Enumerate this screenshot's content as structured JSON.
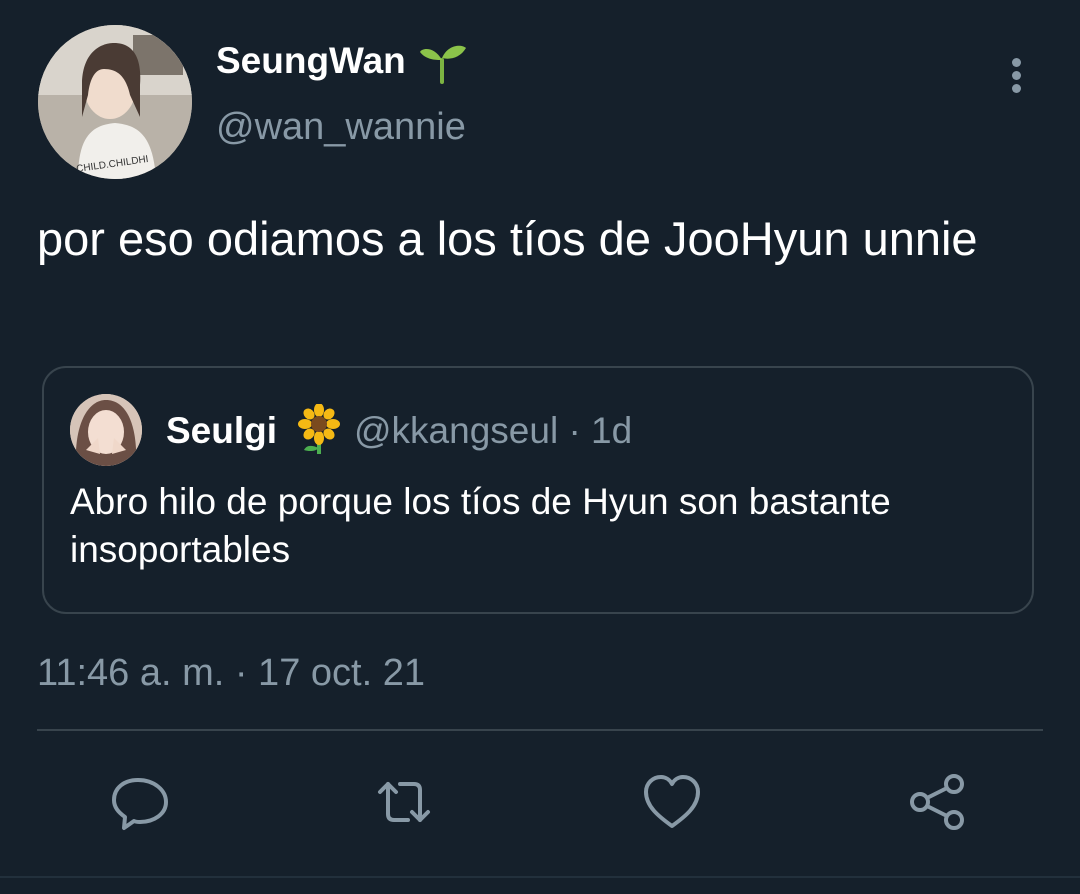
{
  "author": {
    "name": "SeungWan",
    "handle": "@wan_wannie",
    "avatar_shirt_text": "CHILD.CHILDHI"
  },
  "tweet": {
    "text": "por eso odiamos a los tíos de JooHyun unnie",
    "timestamp": "11:46 a. m. · 17 oct. 21"
  },
  "quoted_tweet": {
    "name": "Seulgi",
    "handle_time": "@kkangseul · 1d",
    "text": "Abro hilo de porque los tíos de Hyun son bastante insoportables"
  },
  "icons": {
    "more": "more-vertical-icon",
    "reply": "reply-icon",
    "retweet": "retweet-icon",
    "like": "like-icon",
    "share": "share-icon",
    "badge": "seedling-icon",
    "quote_emoji": "sunflower-icon"
  },
  "colors": {
    "background": "#15202b",
    "secondary_text": "#8899a6",
    "border": "#38444d",
    "badge_green": "#8bc34a",
    "sunflower": "#f5b914"
  }
}
